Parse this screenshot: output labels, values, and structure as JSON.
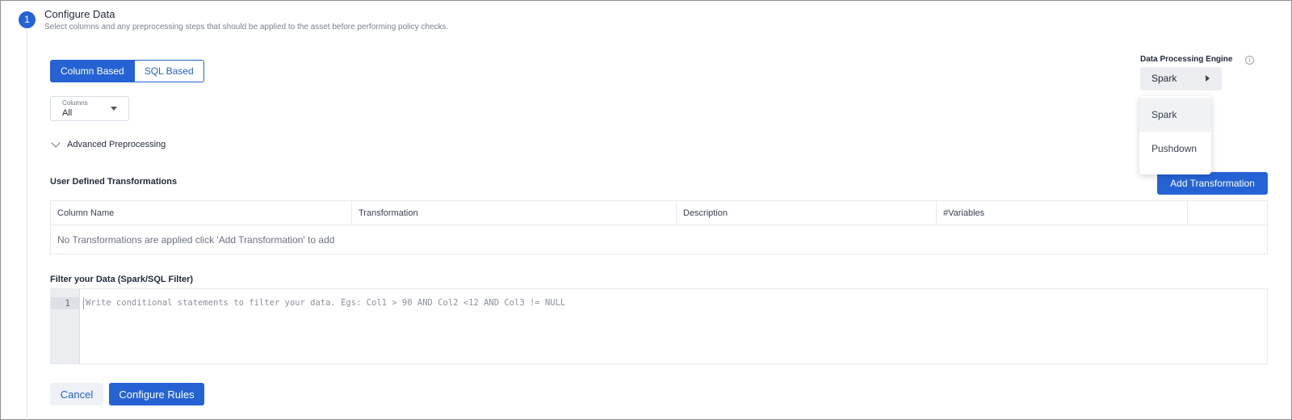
{
  "step": {
    "number": "1",
    "title": "Configure Data",
    "subtitle": "Select columns and any preprocessing steps that should be applied to the asset before performing policy checks."
  },
  "mode_toggle": {
    "options": [
      "Column Based",
      "SQL Based"
    ],
    "selected": "Column Based"
  },
  "columns_select": {
    "label": "Columns",
    "value": "All"
  },
  "advanced": {
    "label": "Advanced Preprocessing"
  },
  "transformations": {
    "title": "User Defined Transformations",
    "add_label": "Add Transformation",
    "columns": [
      "Column Name",
      "Transformation",
      "Description",
      "#Variables",
      ""
    ],
    "empty_message": "No Transformations are applied click 'Add Transformation' to add"
  },
  "filter": {
    "title": "Filter your Data (Spark/SQL Filter)",
    "line_number": "1",
    "placeholder": "Write conditional statements to filter your data. Egs: Col1 > 90 AND Col2 <12 AND Col3 != NULL"
  },
  "footer": {
    "cancel_label": "Cancel",
    "configure_label": "Configure Rules"
  },
  "engine": {
    "label": "Data Processing Engine",
    "info_icon": "info-icon",
    "value": "Spark",
    "options": [
      "Spark",
      "Pushdown"
    ],
    "highlighted": "Spark"
  },
  "colors": {
    "primary": "#2563d4",
    "muted_text": "#7a8190",
    "border": "#e6e9ef"
  }
}
